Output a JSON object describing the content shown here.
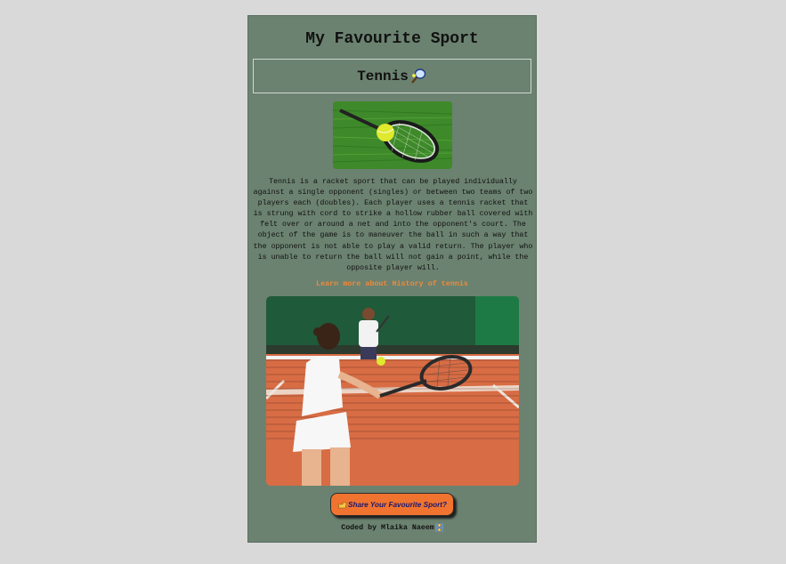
{
  "page": {
    "title": "My Favourite Sport",
    "sport_name": "Tennis",
    "sport_icon": "tennis-racket-icon"
  },
  "images": {
    "top": {
      "alt": "tennis racket and ball on grass",
      "icon": "tennis-racket-photo"
    },
    "main": {
      "alt": "players on a clay tennis court",
      "icon": "tennis-players-photo"
    }
  },
  "description": "Tennis is a racket sport that can be played individually against a single opponent (singles) or between two teams of two players each (doubles). Each player uses a tennis racket that is strung with cord to strike a hollow rubber ball covered with felt over or around a net and into the opponent's court. The object of the game is to maneuver the ball in such a way that the opponent is not able to play a valid return. The player who is unable to return the ball will not gain a point, while the opposite player will.",
  "link": {
    "label": "Learn more about History of tennis"
  },
  "share_button": {
    "label": "Share Your Favourite Sport?",
    "icon": "pointing-hand-icon"
  },
  "footer": {
    "text": "Coded by Mlaika Naeem",
    "icon": "hourglass-icon"
  },
  "colors": {
    "background": "#d9d9d9",
    "card": "#6b8270",
    "link": "#f08a3a",
    "button": "#f07430",
    "button_text": "#1a1870"
  }
}
